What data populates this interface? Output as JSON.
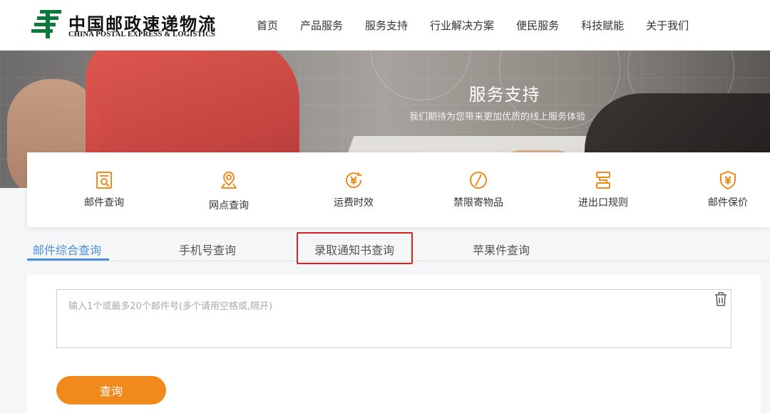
{
  "header": {
    "logo_cn": "中国邮政速递物流",
    "logo_en": "CHINA POSTAL EXPRESS & LOGISTICS",
    "nav": [
      "首页",
      "产品服务",
      "服务支持",
      "行业解决方案",
      "便民服务",
      "科技赋能",
      "关于我们"
    ]
  },
  "banner": {
    "title": "服务支持",
    "subtitle": "我们期待为您带来更加优质的线上服务体验"
  },
  "services": [
    {
      "label": "邮件查询",
      "icon": "mail-search-icon"
    },
    {
      "label": "网点查询",
      "icon": "location-pin-icon"
    },
    {
      "label": "运费时效",
      "icon": "yen-clock-icon"
    },
    {
      "label": "禁限寄物品",
      "icon": "prohibited-icon"
    },
    {
      "label": "进出口规则",
      "icon": "rules-icon"
    },
    {
      "label": "邮件保价",
      "icon": "yen-shield-icon"
    }
  ],
  "tabs": [
    {
      "label": "邮件综合查询",
      "active": true
    },
    {
      "label": "手机号查询",
      "active": false
    },
    {
      "label": "录取通知书查询",
      "active": false,
      "highlighted": true
    },
    {
      "label": "苹果件查询",
      "active": false
    }
  ],
  "query": {
    "placeholder": "输入1个或最多20个邮件号(多个请用空格或,隔开)",
    "value": "",
    "button_label": "查询"
  },
  "colors": {
    "accent_blue": "#4a90d9",
    "accent_orange": "#f08a1c",
    "logo_green": "#0a7a3c",
    "highlight_red": "#e02020"
  }
}
